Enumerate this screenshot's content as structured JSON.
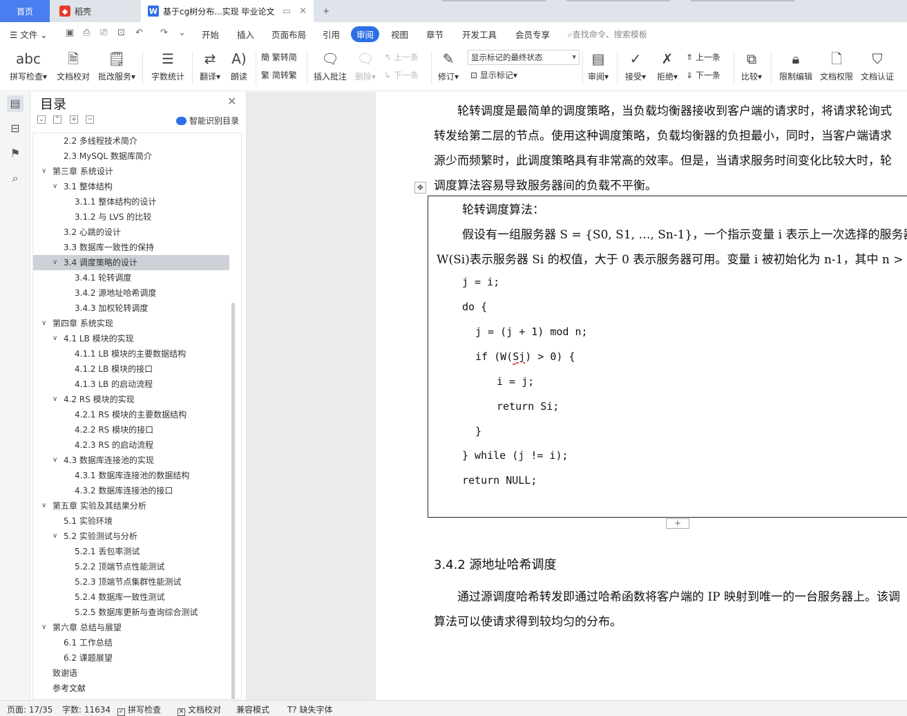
{
  "tabs": {
    "home": "首页",
    "daoke": "稻壳",
    "doc": "基于cg树分布...实现 毕业论文",
    "add": "+"
  },
  "menu": {
    "file": "文件",
    "items": [
      "开始",
      "插入",
      "页面布局",
      "引用",
      "审阅",
      "视图",
      "章节",
      "开发工具",
      "会员专享"
    ],
    "active": "审阅",
    "search": "查找命令、搜索模板"
  },
  "ribbon": {
    "spellcheck": "拼写检查",
    "proofread": "文档校对",
    "batch_service": "批改服务",
    "word_count": "字数统计",
    "translate": "翻译",
    "read_aloud": "朗读",
    "trad_simp": "繁转简",
    "simp_trad": "简转繁",
    "insert_comment": "插入批注",
    "delete": "删除",
    "prev_comment": "上一条",
    "next_comment": "下一条",
    "track": "修订",
    "markup_state": "显示标记的最终状态",
    "show_markup": "显示标记",
    "review": "审阅",
    "accept": "接受",
    "reject": "拒绝",
    "prev_change": "上一条",
    "next_change": "下一条",
    "compare": "比较",
    "restrict_edit": "限制编辑",
    "doc_permission": "文档权限",
    "doc_cert": "文档认证"
  },
  "toc": {
    "title": "目录",
    "smart": "智能识别目录",
    "items": [
      {
        "text": "2.2  多线程技术简介",
        "level": 2,
        "arrow": ""
      },
      {
        "text": "2.3 MySQL 数据库简介",
        "level": 2,
        "arrow": ""
      },
      {
        "text": "第三章  系统设计",
        "level": 1,
        "arrow": "v"
      },
      {
        "text": "3.1  整体结构",
        "level": 2,
        "arrow": "v"
      },
      {
        "text": "3.1.1  整体结构的设计",
        "level": 3,
        "arrow": ""
      },
      {
        "text": "3.1.2  与 LVS 的比较",
        "level": 3,
        "arrow": ""
      },
      {
        "text": "3.2  心跳的设计",
        "level": 2,
        "arrow": ""
      },
      {
        "text": "3.3  数据库一致性的保持",
        "level": 2,
        "arrow": ""
      },
      {
        "text": "3.4  调度策略的设计",
        "level": 2,
        "arrow": "v",
        "selected": true
      },
      {
        "text": "3.4.1  轮转调度",
        "level": 3,
        "arrow": ""
      },
      {
        "text": "3.4.2  源地址哈希调度",
        "level": 3,
        "arrow": ""
      },
      {
        "text": "3.4.3  加权轮转调度",
        "level": 3,
        "arrow": ""
      },
      {
        "text": "第四章  系统实现",
        "level": 1,
        "arrow": "v"
      },
      {
        "text": "4.1 LB 模块的实现",
        "level": 2,
        "arrow": "v"
      },
      {
        "text": "4.1.1 LB 模块的主要数据结构",
        "level": 3,
        "arrow": ""
      },
      {
        "text": "4.1.2 LB 模块的接口",
        "level": 3,
        "arrow": ""
      },
      {
        "text": "4.1.3 LB 的启动流程",
        "level": 3,
        "arrow": ""
      },
      {
        "text": "4.2 RS 模块的实现",
        "level": 2,
        "arrow": "v"
      },
      {
        "text": "4.2.1 RS 模块的主要数据结构",
        "level": 3,
        "arrow": ""
      },
      {
        "text": "4.2.2 RS 模块的接口",
        "level": 3,
        "arrow": ""
      },
      {
        "text": "4.2.3 RS 的启动流程",
        "level": 3,
        "arrow": ""
      },
      {
        "text": "4.3  数据库连接池的实现",
        "level": 2,
        "arrow": "v"
      },
      {
        "text": "4.3.1  数据库连接池的数据结构",
        "level": 3,
        "arrow": ""
      },
      {
        "text": "4.3.2  数据库连接池的接口",
        "level": 3,
        "arrow": ""
      },
      {
        "text": "第五章  实验及其结果分析",
        "level": 1,
        "arrow": "v"
      },
      {
        "text": "5.1  实验环境",
        "level": 2,
        "arrow": ""
      },
      {
        "text": "5.2  实验测试与分析",
        "level": 2,
        "arrow": "v"
      },
      {
        "text": "5.2.1  丢包率测试",
        "level": 3,
        "arrow": ""
      },
      {
        "text": "5.2.2  顶端节点性能测试",
        "level": 3,
        "arrow": ""
      },
      {
        "text": "5.2.3  顶端节点集群性能测试",
        "level": 3,
        "arrow": ""
      },
      {
        "text": "5.2.4  数据库一致性测试",
        "level": 3,
        "arrow": ""
      },
      {
        "text": "5.2.5  数据库更新与查询综合测试",
        "level": 3,
        "arrow": ""
      },
      {
        "text": "第六章  总结与展望",
        "level": 1,
        "arrow": "v"
      },
      {
        "text": "6.1  工作总结",
        "level": 2,
        "arrow": ""
      },
      {
        "text": "6.2  课题展望",
        "level": 2,
        "arrow": ""
      },
      {
        "text": "致谢语",
        "level": 1,
        "arrow": ""
      },
      {
        "text": "参考文献",
        "level": 1,
        "arrow": ""
      }
    ]
  },
  "document": {
    "para1": [
      "轮转调度是最简单的调度策略，当负载均衡器接收到客户端的请求时，将请求轮询式",
      "转发给第二层的节点。使用这种调度策略，负载均衡器的负担最小，同时，当客户端请求",
      "源少而频繁时，此调度策略具有非常高的效率。但是，当请求服务时间变化比较大时，轮",
      "调度算法容易导致服务器间的负载不平衡。"
    ],
    "box_title": "轮转调度算法：",
    "box_desc1": "假设有一组服务器 S = {S0, S1, …, Sn-1}，一个指示变量 i 表示上一次选择的服务器",
    "box_desc2": "W(Si)表示服务器 Si 的权值，大于 0 表示服务器可用。变量 i 被初始化为 n-1，其中 n >",
    "code": {
      "l1": "j = i;",
      "l2": "do {",
      "l3": "j = (j + 1) mod n;",
      "l4a": "if (W(",
      "l4b": "Sj",
      "l4c": ") > 0) {",
      "l5": "i = j;",
      "l6": "return Si;",
      "l7": "}",
      "l8": "} while (j != i);",
      "l9": "return NULL;"
    },
    "heading": "3.4.2 源地址哈希调度",
    "para2": [
      "通过源调度哈希转发即通过哈希函数将客户端的 IP 映射到唯一的一台服务器上。该调",
      "算法可以使请求得到较均匀的分布。"
    ]
  },
  "status": {
    "page": "页面: 17/35",
    "words": "字数: 11634",
    "spell": "拼写检查",
    "proof": "文档校对",
    "compat": "兼容模式",
    "missing_font": "缺失字体"
  }
}
